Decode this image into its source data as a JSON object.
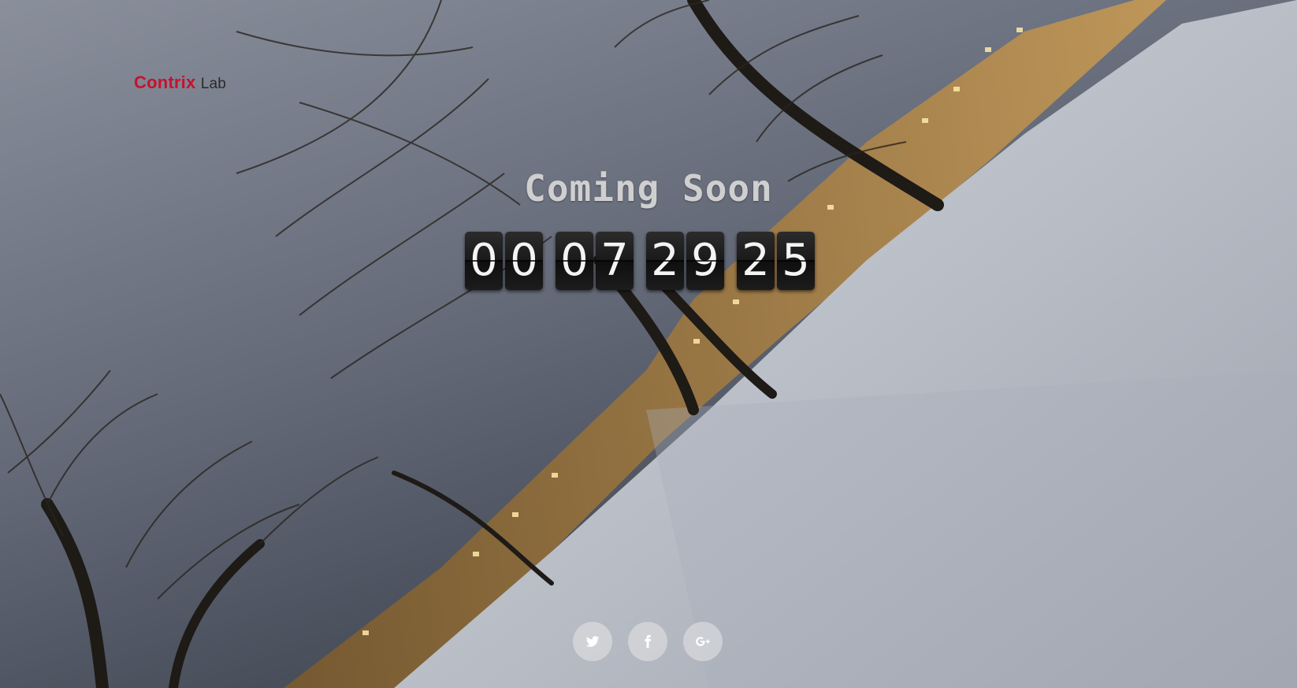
{
  "logo": {
    "brand": "Contrix",
    "sub": "Lab"
  },
  "title": "Coming Soon",
  "countdown": {
    "days": [
      "0",
      "0"
    ],
    "hours": [
      "0",
      "7"
    ],
    "minutes": [
      "2",
      "9"
    ],
    "seconds": [
      "2",
      "5"
    ]
  },
  "social": [
    {
      "name": "twitter-icon"
    },
    {
      "name": "facebook-icon"
    },
    {
      "name": "google-plus-icon"
    }
  ],
  "colors": {
    "brand": "#c8102e",
    "title": "#cfcfcf",
    "tile": "#1a1a1a",
    "snow": "#d8dbe0"
  }
}
